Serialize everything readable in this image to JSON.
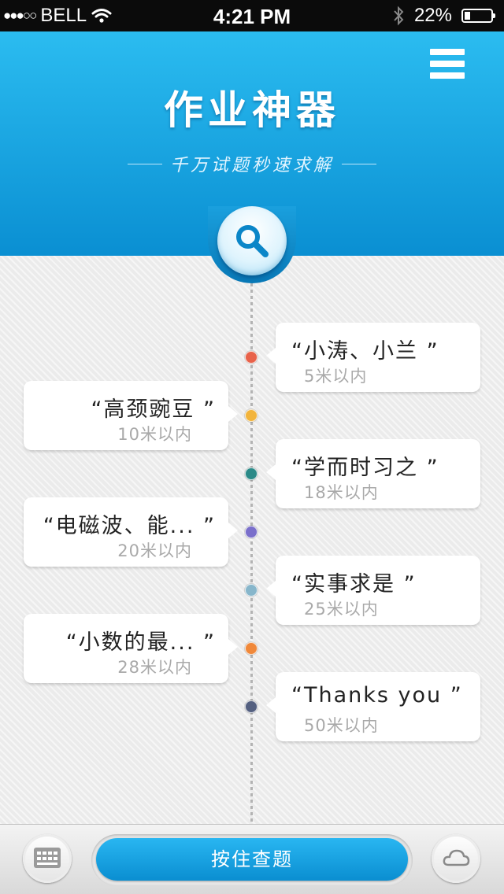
{
  "status_bar": {
    "signal_dots": "●●●○○",
    "carrier": "BELL",
    "time": "4:21 PM",
    "battery_percent": "22%",
    "battery_level": 0.22
  },
  "header": {
    "title": "作业神器",
    "subtitle": "千万试题秒速求解",
    "menu_icon": "hamburger-menu-icon",
    "search_icon": "magnifier-icon"
  },
  "timeline": {
    "items": [
      {
        "title": "“小涛、小兰 ”",
        "distance": "5米以内",
        "side": "right",
        "node_color": "#e8624a"
      },
      {
        "title": "“高颈豌豆 ”",
        "distance": "10米以内",
        "side": "left",
        "node_color": "#f2b43c"
      },
      {
        "title": "“学而时习之 ”",
        "distance": "18米以内",
        "side": "right",
        "node_color": "#2b8a88"
      },
      {
        "title": "“电磁波、能... ”",
        "distance": "20米以内",
        "side": "left",
        "node_color": "#7a6fcb"
      },
      {
        "title": "“实事求是 ”",
        "distance": "25米以内",
        "side": "right",
        "node_color": "#87b6cb"
      },
      {
        "title": "“小数的最... ”",
        "distance": "28米以内",
        "side": "left",
        "node_color": "#f0883a"
      },
      {
        "title": "“Thanks you ”",
        "distance": "50米以内",
        "side": "right",
        "node_color": "#546080"
      }
    ]
  },
  "bottom_bar": {
    "query_button_label": "按住查题",
    "keyboard_icon": "keyboard-icon",
    "cloud_icon": "cloud-icon"
  },
  "colors": {
    "header_top": "#2bbcf0",
    "header_bottom": "#0a8fd2",
    "accent": "#0a8fd2"
  }
}
